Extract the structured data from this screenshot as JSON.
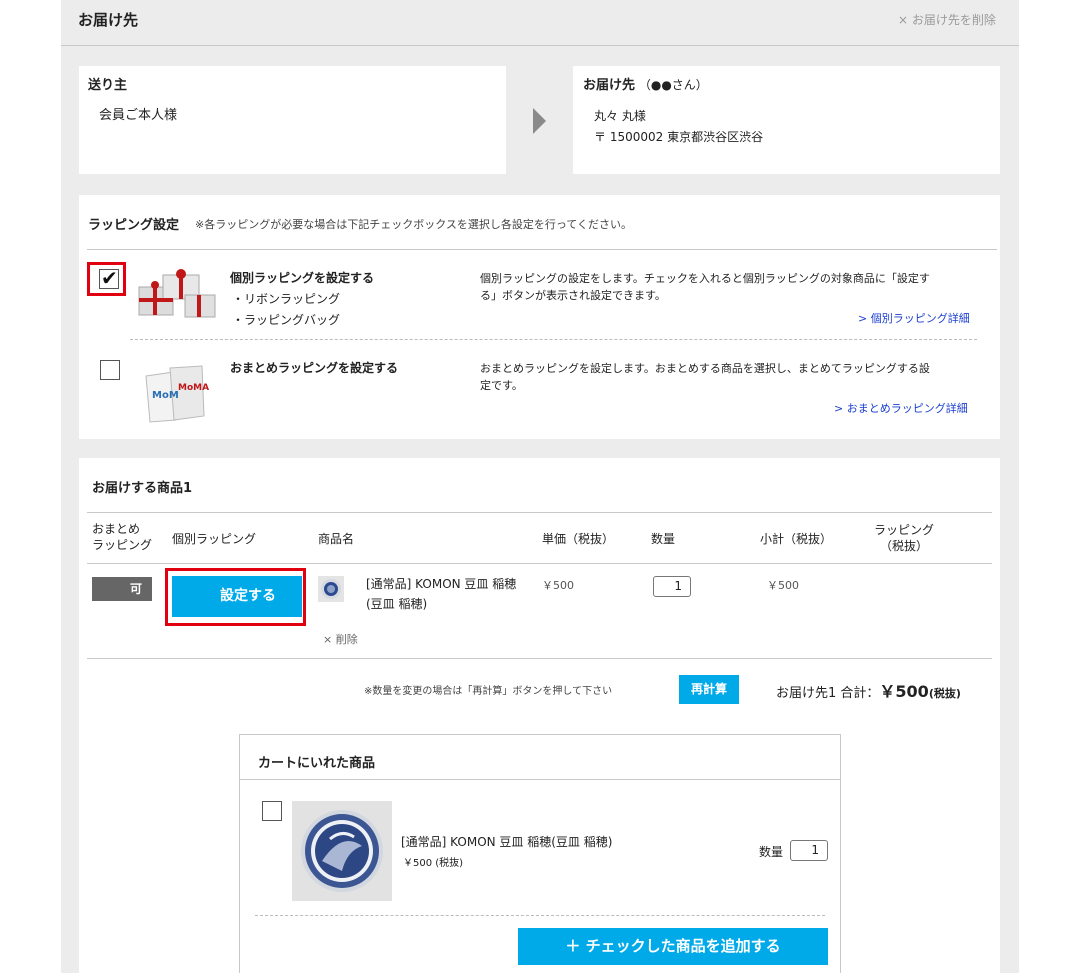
{
  "header": {
    "title": "お届け先",
    "delete_label": "× お届け先を削除"
  },
  "sender": {
    "label": "送り主",
    "name": "会員ご本人様"
  },
  "recipient": {
    "label": "お届け先",
    "note": "（●●さん）",
    "name": "丸々 丸様",
    "address": "〒 1500002 東京都渋谷区渋谷"
  },
  "wrapping": {
    "title": "ラッピング設定",
    "note": "※各ラッピングが必要な場合は下記チェックボックスを選択し各設定を行ってください。",
    "individual": {
      "checked": true,
      "title": "個別ラッピングを設定する",
      "option1": "・リボンラッピング",
      "option2": "・ラッピングバッグ",
      "desc1": "個別ラッピングの設定をします。チェックを入れると個別ラッピングの対象商品に「設定す",
      "desc2": "る」ボタンが表示され設定できます。",
      "link": "> 個別ラッピング詳細"
    },
    "bulk": {
      "checked": false,
      "title": "おまとめラッピングを設定する",
      "desc1": "おまとめラッピングを設定します。おまとめする商品を選択し、まとめてラッピングする設",
      "desc2": "定です。",
      "link": "> おまとめラッピング詳細"
    }
  },
  "delivery": {
    "title": "お届けする商品1",
    "columns": {
      "bulk1": "おまとめ",
      "bulk2": "ラッピング",
      "individual": "個別ラッピング",
      "name": "商品名",
      "price": "単価（税抜）",
      "qty": "数量",
      "subtotal": "小計（税抜）",
      "wrap1": "ラッピング",
      "wrap2": "（税抜）"
    },
    "row": {
      "bulk_status": "可",
      "set_button": "設定する",
      "name1": "[通常品] KOMON 豆皿 稲穂",
      "name2": "(豆皿 稲穂)",
      "price": "￥500",
      "qty": "1",
      "subtotal": "￥500",
      "delete": "× 削除"
    },
    "recalc_note": "※数量を変更の場合は「再計算」ボタンを押して下さい",
    "recalc_button": "再計算",
    "total_label": "お届け先1 合計：",
    "total_value": "￥500",
    "total_tax": "(税抜)"
  },
  "cart": {
    "title": "カートにいれた商品",
    "item_name": "[通常品] KOMON 豆皿 稲穂(豆皿 稲穂)",
    "item_price": "￥500 (税抜)",
    "qty_label": "数量",
    "qty_value": "1",
    "add_button": "＋ チェックした商品を追加する"
  }
}
